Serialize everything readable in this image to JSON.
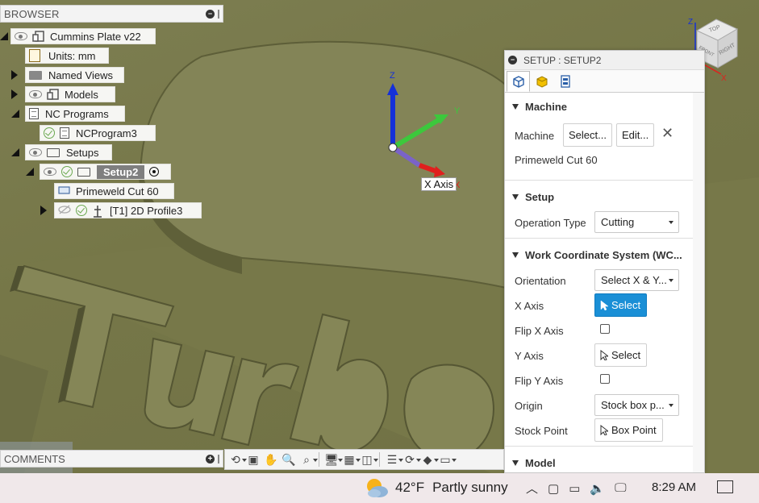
{
  "browser": {
    "title": "BROWSER",
    "items": [
      {
        "label": "Cummins Plate v22"
      },
      {
        "label": "Units: mm"
      },
      {
        "label": "Named Views"
      },
      {
        "label": "Models"
      },
      {
        "label": "NC Programs"
      },
      {
        "label": "NCProgram3"
      },
      {
        "label": "Setups"
      },
      {
        "label": "Setup2"
      },
      {
        "label": "Primeweld Cut 60"
      },
      {
        "label": "[T1] 2D Profile3"
      }
    ]
  },
  "viewport": {
    "axis_tooltip": "X Axis",
    "triad_labels": {
      "z": "Z",
      "y": "Y",
      "x": "X"
    },
    "viewcube": {
      "z": "Z",
      "top": "TOP",
      "front": "FRONT",
      "right": "RIGHT",
      "x": "X"
    }
  },
  "dialog": {
    "title": "SETUP : SETUP2",
    "tabs": [
      "setup-tab",
      "stock-tab",
      "post-process-tab"
    ],
    "machine": {
      "header": "Machine",
      "label": "Machine",
      "select_button": "Select...",
      "edit_button": "Edit...",
      "machine_name": "Primeweld Cut 60"
    },
    "setup": {
      "header": "Setup",
      "operation_type_label": "Operation Type",
      "operation_type_value": "Cutting"
    },
    "wcs": {
      "header": "Work Coordinate System (WC...",
      "orientation_label": "Orientation",
      "orientation_value": "Select X & Y...",
      "x_axis_label": "X Axis",
      "x_axis_button": "Select",
      "flip_x_label": "Flip X Axis",
      "y_axis_label": "Y Axis",
      "y_axis_button": "Select",
      "flip_y_label": "Flip Y Axis",
      "origin_label": "Origin",
      "origin_value": "Stock box p...",
      "stock_point_label": "Stock Point",
      "stock_point_button": "Box Point"
    },
    "model": {
      "header": "Model"
    }
  },
  "comments": {
    "title": "COMMENTS"
  },
  "taskbar": {
    "temperature": "42°F",
    "weather": "Partly sunny",
    "time": "8:29 AM"
  },
  "colors": {
    "accent": "#1a8fd6",
    "viewport": "#7a7b4f",
    "axis_x": "#e0201e",
    "axis_y": "#3cc83c",
    "axis_z": "#1530d8"
  }
}
